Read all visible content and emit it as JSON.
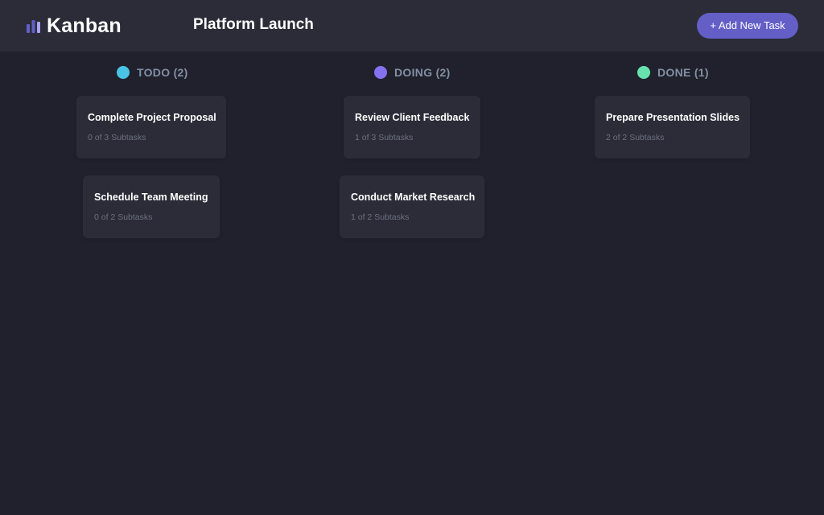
{
  "app": {
    "logo_text": "Kanban",
    "logo_icon": "bar-chart-icon",
    "board_title": "Platform Launch",
    "add_task_label": "+ Add New Task"
  },
  "colors": {
    "background": "#20212c",
    "surface": "#2b2c37",
    "accent": "#635fc7",
    "muted": "#828fa3",
    "todo": "#49c4e5",
    "doing": "#8471f2",
    "done": "#67e2ae"
  },
  "columns": [
    {
      "label": "TODO (2)",
      "dot_color": "#49c4e5",
      "tasks": [
        {
          "title": "Complete Project Proposal",
          "subtasks": "0 of 3 Subtasks"
        },
        {
          "title": "Schedule Team Meeting",
          "subtasks": "0 of 2 Subtasks"
        }
      ]
    },
    {
      "label": "DOING (2)",
      "dot_color": "#8471f2",
      "tasks": [
        {
          "title": "Review Client Feedback",
          "subtasks": "1 of 3 Subtasks"
        },
        {
          "title": "Conduct Market Research",
          "subtasks": "1 of 2 Subtasks"
        }
      ]
    },
    {
      "label": "DONE (1)",
      "dot_color": "#67e2ae",
      "tasks": [
        {
          "title": "Prepare Presentation Slides",
          "subtasks": "2 of 2 Subtasks"
        }
      ]
    }
  ]
}
